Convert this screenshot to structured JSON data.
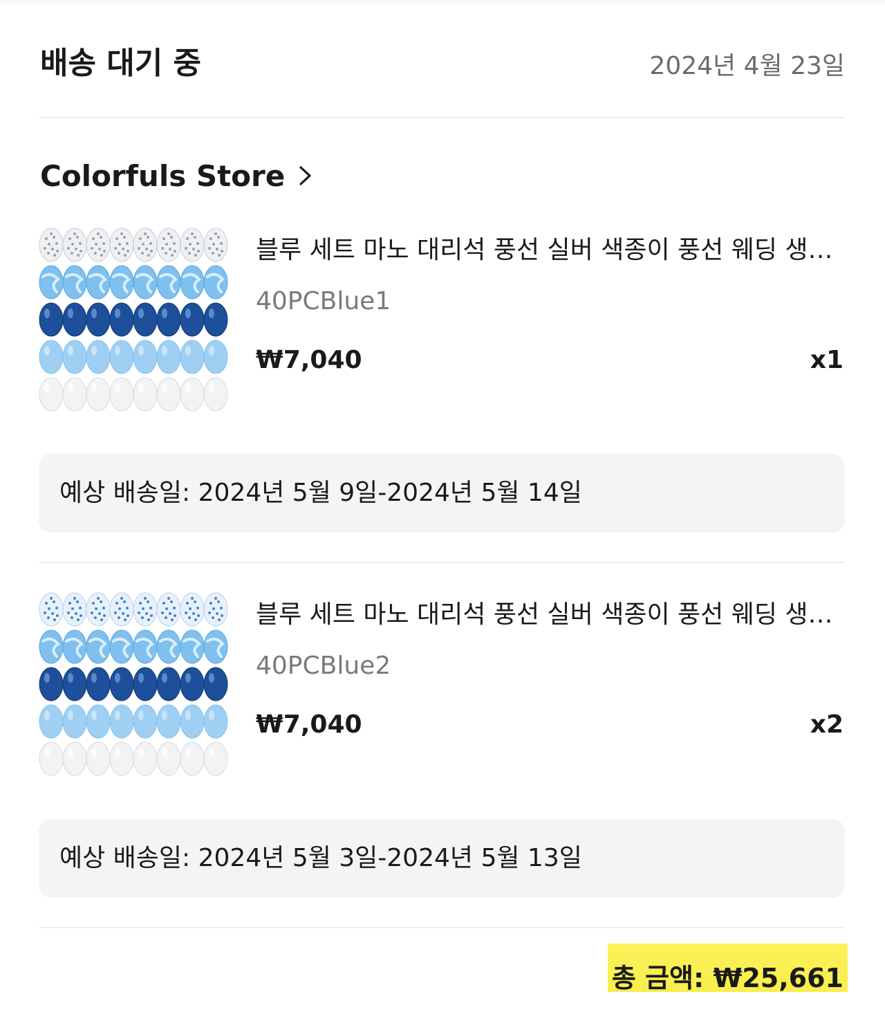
{
  "order": {
    "status": "배송 대기 중",
    "date": "2024년 4월 23일"
  },
  "store": {
    "name": "Colorfuls Store",
    "chevron_icon": "chevron-right-icon"
  },
  "items": [
    {
      "title": "블루 세트 마노 대리석 풍선 실버 색종이 풍선 웨딩 생일 파티 장식",
      "variant": "40PCBlue1",
      "price": "₩7,040",
      "quantity": "x1",
      "thumbnail_rows": [
        "silver-confetti",
        "light-blue-marble",
        "dark-blue-metallic",
        "light-blue",
        "white-pearl"
      ],
      "delivery": "예상 배송일: 2024년 5월 9일-2024년 5월 14일"
    },
    {
      "title": "블루 세트 마노 대리석 풍선 실버 색종이 풍선 웨딩 생일 파티 장식",
      "variant": "40PCBlue2",
      "price": "₩7,040",
      "quantity": "x2",
      "thumbnail_rows": [
        "blue-confetti",
        "light-blue-marble",
        "dark-blue-metallic",
        "light-blue",
        "white-pearl"
      ],
      "delivery": "예상 배송일: 2024년 5월 3일-2024년 5월 13일"
    }
  ],
  "total": {
    "text": "총 금액: ₩25,661",
    "highlight_color": "#f9ef4f"
  },
  "colors": {
    "text_primary": "#1a1a1a",
    "text_secondary": "#7a7a7a",
    "box_background": "#f4f4f4",
    "divider": "#eeeeee"
  }
}
